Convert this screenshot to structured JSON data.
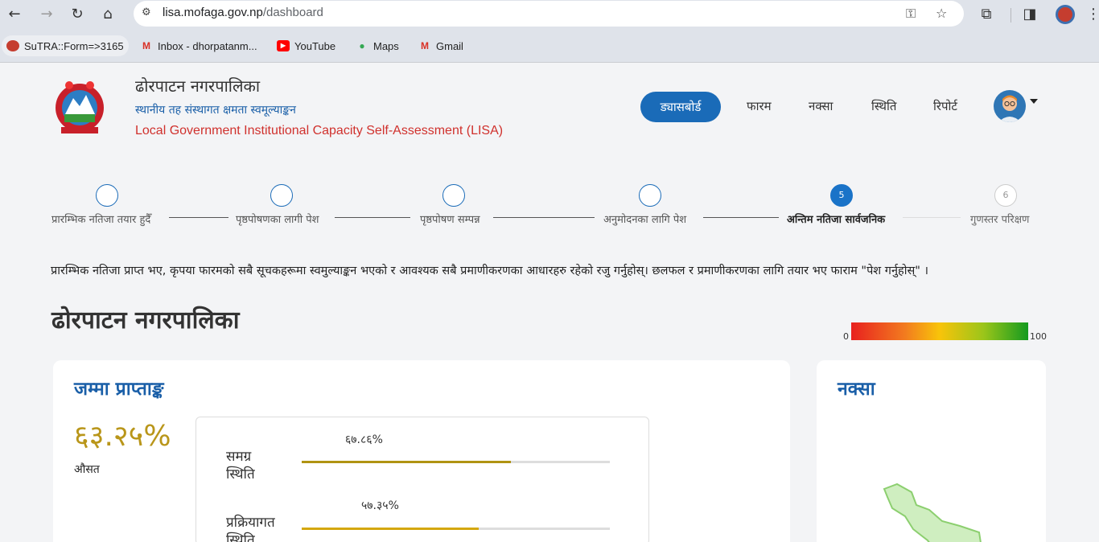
{
  "browser": {
    "url_host": "lisa.mofaga.gov.np",
    "url_path": "/dashboard",
    "bookmarks": [
      {
        "label": "SuTRA::Form=>3165"
      },
      {
        "label": "Inbox - dhorpatanm..."
      },
      {
        "label": "YouTube"
      },
      {
        "label": "Maps"
      },
      {
        "label": "Gmail"
      }
    ]
  },
  "header": {
    "org_name": "ढोरपाटन नगरपालिका",
    "subtitle_np": "स्थानीय तह संस्थागत क्षमता स्वमूल्याङ्कन",
    "subtitle_en": "Local Government Institutional Capacity Self-Assessment (LISA)",
    "menu": [
      "ड्यासबोर्ड",
      "फारम",
      "नक्सा",
      "स्थिति",
      "रिपोर्ट"
    ]
  },
  "stepper": {
    "steps": [
      {
        "label": "प्रारम्भिक नतिजा तयार हुदैँ"
      },
      {
        "label": "पृष्ठपोषणका लागी पेश"
      },
      {
        "label": "पृष्ठपोषण सम्पन्न"
      },
      {
        "label": "अनुमोदनका लागि पेश"
      },
      {
        "label": "अन्तिम नतिजा सार्वजनिक",
        "number": "5"
      },
      {
        "label": "गुणस्तर परिक्षण",
        "number": "6"
      }
    ]
  },
  "notice": "प्रारम्भिक नतिजा प्राप्त भए, कृपया फारमको सबै सूचकहरूमा स्वमुल्याङ्कन भएको र आवश्यक सबै प्रमाणीकरणका आधारहरु रहेको रजु गर्नुहोस्। छलफल र प्रमाणीकरणका लागि तयार भए फाराम \"पेश गर्नुहोस्\" ।",
  "municipality_title": "ढोरपाटन नगरपालिका",
  "scale": {
    "min": "0",
    "max": "100"
  },
  "score_card": {
    "title": "जम्मा प्राप्ताङ्क",
    "total_pct": "६३.२५%",
    "avg_label": "औसत",
    "bars": [
      {
        "label": "समग्र\nस्थिति",
        "value_text": "६७.८६%",
        "value": 67.86,
        "color": "#b09312"
      },
      {
        "label": "प्रक्रियागत\nस्थिति",
        "value_text": "५७.३५%",
        "value": 57.35,
        "color": "#d4a70d"
      }
    ]
  },
  "map_card": {
    "title": "नक्सा"
  },
  "colors": {
    "brand_blue": "#1a6bb8",
    "score_gold": "#b9961a",
    "red_accent": "#d0312d"
  }
}
